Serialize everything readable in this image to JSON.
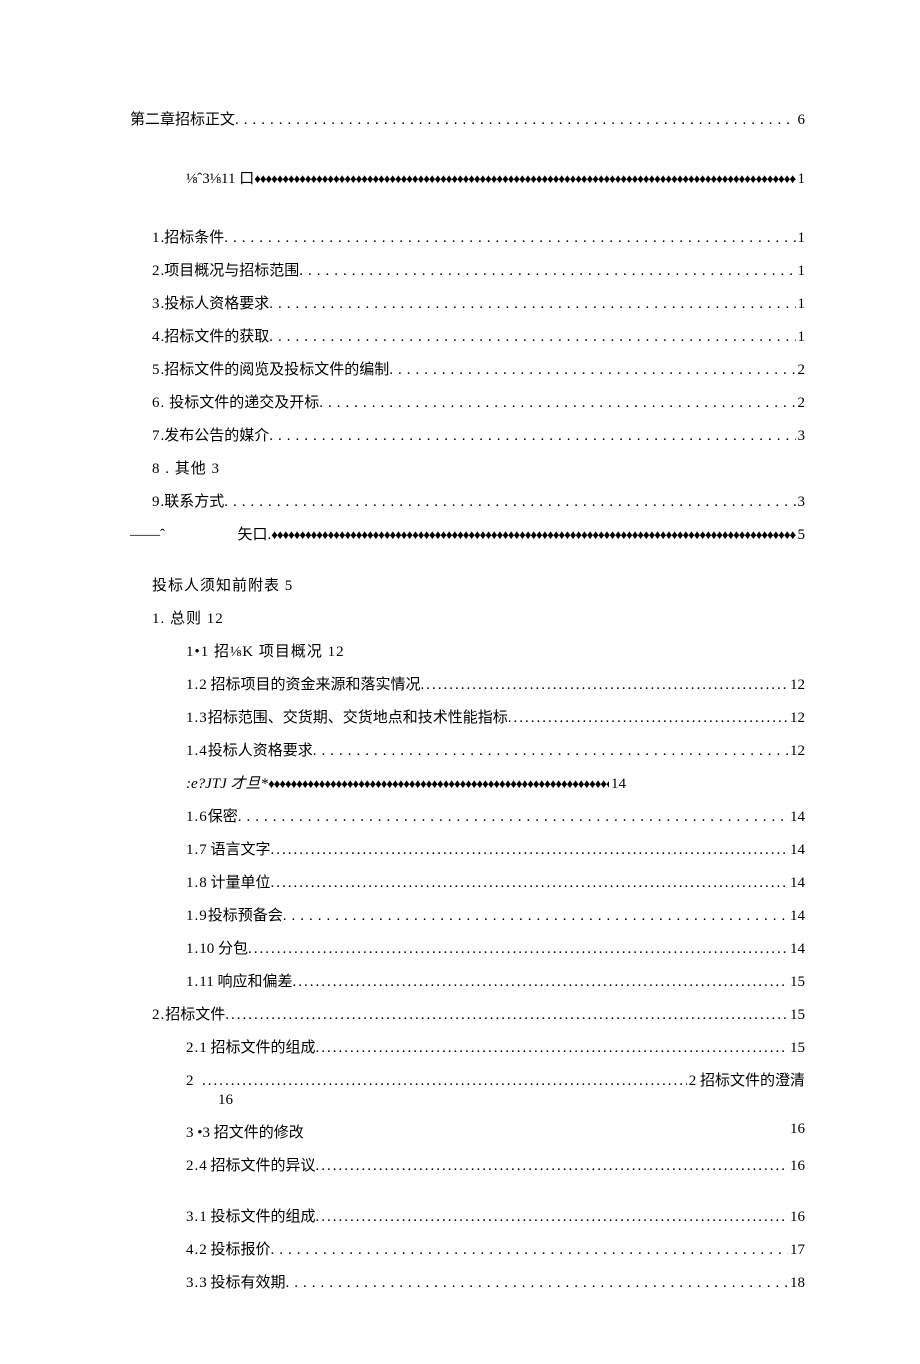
{
  "main_ch": {
    "label": "第二章招标正文",
    "page": "6"
  },
  "garble1": {
    "label": "⅛ˆ3⅛11 口",
    "page": "1"
  },
  "l1": {
    "pre": "1",
    "sep": " . ",
    "label": "招标条件",
    "page": "1"
  },
  "l2": {
    "pre": "2",
    "sep": " . ",
    "label": "项目概况与招标范围",
    "page": "1"
  },
  "l3": {
    "pre": "3",
    "sep": " . ",
    "label": "投标人资格要求",
    "page": "1"
  },
  "l4": {
    "pre": "4",
    "sep": " . ",
    "label": "招标文件的获取",
    "page": "1"
  },
  "l5": {
    "pre": "5",
    "sep": " . ",
    "label": "招标文件的阅览及投标文件的编制",
    "page": "2"
  },
  "l6": {
    "pre": "6",
    "sep": " .   ",
    "label": "投标文件的递交及开标",
    "page": "2"
  },
  "l7": {
    "pre": "7",
    "sep": " . ",
    "label": "发布公告的媒介",
    "page": "3"
  },
  "l8_text": "8  . 其他 3",
  "l9": {
    "pre": "9",
    "sep": " . ",
    "label": "联系方式",
    "page": "3"
  },
  "garble2": {
    "pre": "——ˆ",
    "label": "矢口.",
    "page": "5"
  },
  "notice_text": "投标人须知前附表     5",
  "s1_text": "1. 总则 12",
  "s11_text": "1•1 招⅛K 项目概况 12",
  "s12": {
    "pre": "1.",
    "sep": "  ",
    "label": "2 招标项目的资金来源和落实情况",
    "page": "12"
  },
  "s13": {
    "pre": "1.3",
    "sep": "  ",
    "label": "招标范围、交货期、交货地点和技术性能指标",
    "page": "12"
  },
  "s14": {
    "pre": "1.4",
    "sep": "  ",
    "label": "投标人资格要求",
    "page": "12"
  },
  "s15_garble": {
    "label": ":e?JTJ 才旦*",
    "page": "14"
  },
  "s16": {
    "pre": "1.6",
    "sep": " ",
    "label": "保密",
    "page": "14"
  },
  "s17": {
    "pre": "1.",
    "sep": "  ",
    "label": "7 语言文字",
    "page": "14"
  },
  "s18": {
    "pre": "1.",
    "sep": "  ",
    "label": "8 计量单位",
    "page": "14"
  },
  "s19": {
    "pre": "1.9",
    "sep": " ",
    "label": "投标预备会",
    "page": "14"
  },
  "s110": {
    "pre": "1.",
    "sep": "  ",
    "label": "10 分包",
    "page": "14"
  },
  "s111": {
    "pre": "1.",
    "sep": "  ",
    "label": "11 响应和偏差",
    "page": "15"
  },
  "s2hdr": {
    "pre": "2.",
    "sep": " ",
    "label": "招标文件",
    "page": "15"
  },
  "s21": {
    "pre": "2.",
    "sep": "  ",
    "label": "1 招标文件的组成",
    "page": "15"
  },
  "s22_line1_pre": "2",
  "s22_line1_page": "2 招标文件的澄清",
  "s22_line2": "16",
  "s23_left": "3  •3 招文件的修改",
  "s23_right": "16",
  "s24": {
    "pre": "2.",
    "sep": "  ",
    "label": "4 招标文件的异议",
    "page": "16"
  },
  "s31": {
    "pre": "3.",
    "sep": "  ",
    "label": "1 投标文件的组成",
    "page": "16"
  },
  "s42": {
    "pre": "4.",
    "sep": "  ",
    "label": "2 投标报价",
    "page": "17"
  },
  "s33": {
    "pre": "3.",
    "sep": "  ",
    "label": "3 投标有效期",
    "page": "18"
  }
}
